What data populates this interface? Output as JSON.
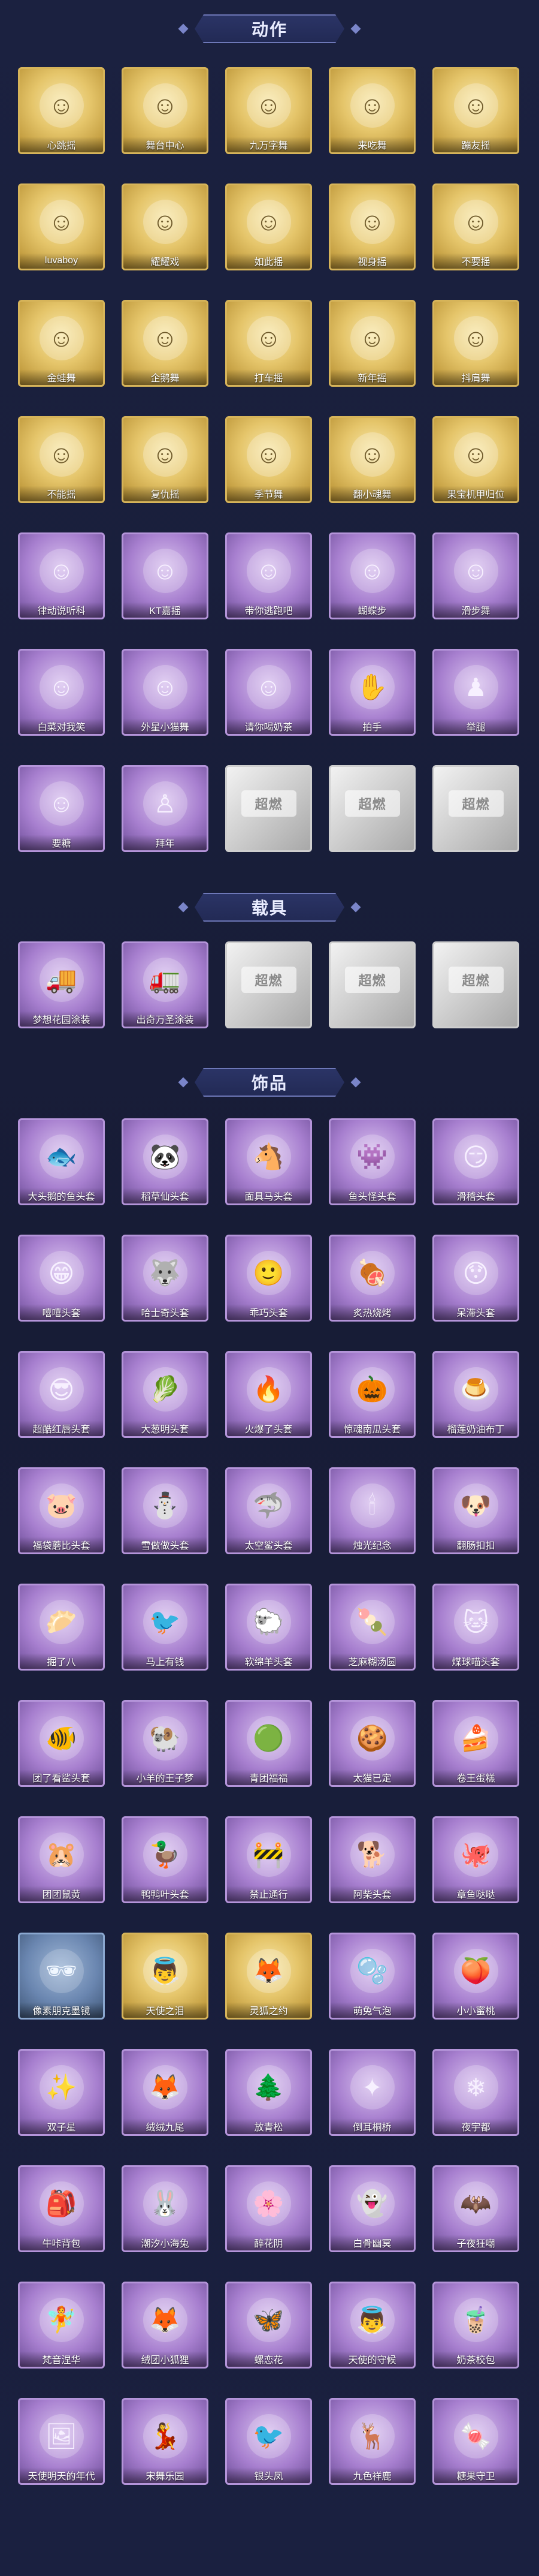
{
  "sections": [
    {
      "title": "动作",
      "items": [
        {
          "label": "心跳摇",
          "rarity": "gold",
          "icon": "dance-pose-icon"
        },
        {
          "label": "舞台中心",
          "rarity": "gold",
          "icon": "dance-pose-icon"
        },
        {
          "label": "九万字舞",
          "rarity": "gold",
          "icon": "dance-pose-icon"
        },
        {
          "label": "来吃舞",
          "rarity": "gold",
          "icon": "dance-pose-icon"
        },
        {
          "label": "蹦友摇",
          "rarity": "gold",
          "icon": "dance-pose-icon"
        },
        {
          "label": "luvaboy",
          "rarity": "gold",
          "icon": "dance-pose-icon"
        },
        {
          "label": "耀耀戏",
          "rarity": "gold",
          "icon": "dance-pose-icon"
        },
        {
          "label": "如此摇",
          "rarity": "gold",
          "icon": "dance-pose-icon"
        },
        {
          "label": "视身摇",
          "rarity": "gold",
          "icon": "dance-pose-icon"
        },
        {
          "label": "不要摇",
          "rarity": "gold",
          "icon": "dance-pose-icon"
        },
        {
          "label": "金蛙舞",
          "rarity": "gold",
          "icon": "dance-pose-icon"
        },
        {
          "label": "企鹅舞",
          "rarity": "gold",
          "icon": "dance-pose-icon"
        },
        {
          "label": "打车摇",
          "rarity": "gold",
          "icon": "dance-pose-icon"
        },
        {
          "label": "新年摇",
          "rarity": "gold",
          "icon": "dance-pose-icon"
        },
        {
          "label": "抖肩舞",
          "rarity": "gold",
          "icon": "dance-pose-icon"
        },
        {
          "label": "不能摇",
          "rarity": "gold",
          "icon": "dance-pose-icon"
        },
        {
          "label": "复仇摇",
          "rarity": "gold",
          "icon": "dance-pose-icon"
        },
        {
          "label": "季节舞",
          "rarity": "gold",
          "icon": "dance-pose-icon"
        },
        {
          "label": "翻小魂舞",
          "rarity": "gold",
          "icon": "dance-pose-icon"
        },
        {
          "label": "果宝机甲归位",
          "rarity": "gold",
          "icon": "dance-pose-icon"
        },
        {
          "label": "律动说听科",
          "rarity": "purple",
          "icon": "dance-pose-icon"
        },
        {
          "label": "KT嘉摇",
          "rarity": "purple",
          "icon": "dance-pose-icon"
        },
        {
          "label": "带你逃跑吧",
          "rarity": "purple",
          "icon": "dance-pose-icon"
        },
        {
          "label": "蝴蝶步",
          "rarity": "purple",
          "icon": "dance-pose-icon"
        },
        {
          "label": "滑步舞",
          "rarity": "purple",
          "icon": "dance-pose-icon"
        },
        {
          "label": "白菜对我笑",
          "rarity": "purple",
          "icon": "dance-pose-icon"
        },
        {
          "label": "外星小猫舞",
          "rarity": "purple",
          "icon": "dance-pose-icon"
        },
        {
          "label": "请你喝奶茶",
          "rarity": "purple",
          "icon": "dance-pose-icon"
        },
        {
          "label": "拍手",
          "rarity": "purple",
          "icon": "clap-icon"
        },
        {
          "label": "举腿",
          "rarity": "purple",
          "icon": "leg-raise-icon"
        },
        {
          "label": "要糖",
          "rarity": "purple",
          "icon": "dance-pose-icon"
        },
        {
          "label": "拜年",
          "rarity": "purple",
          "icon": "bow-icon"
        },
        {
          "label": "",
          "rarity": "silver",
          "icon": "placeholder-logo-icon",
          "placeholder": "超燃"
        },
        {
          "label": "",
          "rarity": "silver",
          "icon": "placeholder-logo-icon",
          "placeholder": "超燃"
        },
        {
          "label": "",
          "rarity": "silver",
          "icon": "placeholder-logo-icon",
          "placeholder": "超燃"
        }
      ]
    },
    {
      "title": "载具",
      "items": [
        {
          "label": "梦想花园涂装",
          "rarity": "purple",
          "icon": "food-truck-icon"
        },
        {
          "label": "出奇万圣涂装",
          "rarity": "purple",
          "icon": "truck-icon"
        },
        {
          "label": "",
          "rarity": "silver",
          "icon": "placeholder-logo-icon",
          "placeholder": "超燃"
        },
        {
          "label": "",
          "rarity": "silver",
          "icon": "placeholder-logo-icon",
          "placeholder": "超燃"
        },
        {
          "label": "",
          "rarity": "silver",
          "icon": "placeholder-logo-icon",
          "placeholder": "超燃"
        }
      ]
    },
    {
      "title": "饰品",
      "items": [
        {
          "label": "大头鹅的鱼头套",
          "rarity": "purple",
          "icon": "fish-head-icon"
        },
        {
          "label": "稻草仙头套",
          "rarity": "purple",
          "icon": "panda-head-icon"
        },
        {
          "label": "面具马头套",
          "rarity": "purple",
          "icon": "horse-head-icon"
        },
        {
          "label": "鱼头怪头套",
          "rarity": "purple",
          "icon": "fish-monster-icon"
        },
        {
          "label": "滑稽头套",
          "rarity": "purple",
          "icon": "smile-face-icon"
        },
        {
          "label": "嘻嘻头套",
          "rarity": "purple",
          "icon": "grin-face-icon"
        },
        {
          "label": "哈士奇头套",
          "rarity": "purple",
          "icon": "husky-head-icon"
        },
        {
          "label": "乖巧头套",
          "rarity": "purple",
          "icon": "cute-face-icon"
        },
        {
          "label": "炙热烧烤",
          "rarity": "purple",
          "icon": "bbq-icon"
        },
        {
          "label": "呆滞头套",
          "rarity": "purple",
          "icon": "dazed-face-icon"
        },
        {
          "label": "超酷红唇头套",
          "rarity": "purple",
          "icon": "cool-duck-icon"
        },
        {
          "label": "大葱明头套",
          "rarity": "purple",
          "icon": "vegetable-head-icon"
        },
        {
          "label": "火爆了头套",
          "rarity": "purple",
          "icon": "fire-face-icon"
        },
        {
          "label": "惊魂南瓜头套",
          "rarity": "purple",
          "icon": "pumpkin-icon"
        },
        {
          "label": "榴莲奶油布丁",
          "rarity": "purple",
          "icon": "pudding-icon"
        },
        {
          "label": "福袋蘑比头套",
          "rarity": "purple",
          "icon": "pig-head-icon"
        },
        {
          "label": "雪做做头套",
          "rarity": "purple",
          "icon": "snowman-icon"
        },
        {
          "label": "太空鲨头套",
          "rarity": "purple",
          "icon": "shark-head-icon"
        },
        {
          "label": "烛光纪念",
          "rarity": "purple",
          "icon": "candle-icon"
        },
        {
          "label": "翻肠扣扣",
          "rarity": "purple",
          "icon": "dog-head-icon"
        },
        {
          "label": "掘了八",
          "rarity": "purple",
          "icon": "bun-icon"
        },
        {
          "label": "马上有钱",
          "rarity": "purple",
          "icon": "bird-icon"
        },
        {
          "label": "软绵羊头套",
          "rarity": "purple",
          "icon": "sheep-head-icon"
        },
        {
          "label": "芝麻糊汤圆",
          "rarity": "purple",
          "icon": "dumpling-icon"
        },
        {
          "label": "煤球喵头套",
          "rarity": "purple",
          "icon": "cat-head-icon"
        },
        {
          "label": "团了看鲨头套",
          "rarity": "purple",
          "icon": "fish-icon"
        },
        {
          "label": "小羊的王子梦",
          "rarity": "purple",
          "icon": "lamb-icon"
        },
        {
          "label": "青团福福",
          "rarity": "purple",
          "icon": "green-bun-icon"
        },
        {
          "label": "太猫已定",
          "rarity": "purple",
          "icon": "cookie-icon"
        },
        {
          "label": "卷王蛋糕",
          "rarity": "purple",
          "icon": "cake-roll-icon"
        },
        {
          "label": "团团鼠黄",
          "rarity": "purple",
          "icon": "hamster-icon"
        },
        {
          "label": "鸭鸭叶头套",
          "rarity": "purple",
          "icon": "duck-icon"
        },
        {
          "label": "禁止通行",
          "rarity": "purple",
          "icon": "traffic-cone-icon"
        },
        {
          "label": "阿柴头套",
          "rarity": "purple",
          "icon": "shiba-icon"
        },
        {
          "label": "章鱼哒哒",
          "rarity": "purple",
          "icon": "octopus-icon"
        },
        {
          "label": "像素朋克墨镜",
          "rarity": "blue",
          "icon": "pixel-glasses-icon"
        },
        {
          "label": "天使之泪",
          "rarity": "gold",
          "icon": "halo-icon"
        },
        {
          "label": "灵狐之约",
          "rarity": "gold",
          "icon": "fox-icon"
        },
        {
          "label": "萌兔气泡",
          "rarity": "purple",
          "icon": "bubble-icon"
        },
        {
          "label": "小小蜜桃",
          "rarity": "purple",
          "icon": "peach-icon"
        },
        {
          "label": "双子星",
          "rarity": "purple",
          "icon": "twin-star-icon"
        },
        {
          "label": "绒绒九尾",
          "rarity": "purple",
          "icon": "nine-tail-fox-icon"
        },
        {
          "label": "放青松",
          "rarity": "purple",
          "icon": "tree-icon"
        },
        {
          "label": "倒耳桐桥",
          "rarity": "purple",
          "icon": "ornament-icon"
        },
        {
          "label": "夜宇都",
          "rarity": "purple",
          "icon": "crystal-icon"
        },
        {
          "label": "牛咔背包",
          "rarity": "purple",
          "icon": "backpack-icon"
        },
        {
          "label": "潮汐小海兔",
          "rarity": "purple",
          "icon": "sea-rabbit-icon"
        },
        {
          "label": "醉花阴",
          "rarity": "purple",
          "icon": "flower-icon"
        },
        {
          "label": "白骨幽冥",
          "rarity": "purple",
          "icon": "ghost-icon"
        },
        {
          "label": "子夜狂嘲",
          "rarity": "purple",
          "icon": "bat-wing-icon"
        },
        {
          "label": "梵音涅华",
          "rarity": "purple",
          "icon": "fairy-icon"
        },
        {
          "label": "绒团小狐狸",
          "rarity": "purple",
          "icon": "fox-doll-icon"
        },
        {
          "label": "螺恋花",
          "rarity": "purple",
          "icon": "butterfly-flower-icon"
        },
        {
          "label": "天使的守候",
          "rarity": "purple",
          "icon": "angel-icon"
        },
        {
          "label": "奶茶校包",
          "rarity": "purple",
          "icon": "milk-tea-icon"
        },
        {
          "label": "天使明天的年代",
          "rarity": "purple",
          "icon": "angel-frame-icon"
        },
        {
          "label": "宋舞乐园",
          "rarity": "purple",
          "icon": "dancer-doll-icon"
        },
        {
          "label": "银头凤",
          "rarity": "purple",
          "icon": "phoenix-doll-icon"
        },
        {
          "label": "九色祥鹿",
          "rarity": "purple",
          "icon": "deer-icon"
        },
        {
          "label": "糖果守卫",
          "rarity": "purple",
          "icon": "candy-guard-icon"
        }
      ]
    }
  ]
}
